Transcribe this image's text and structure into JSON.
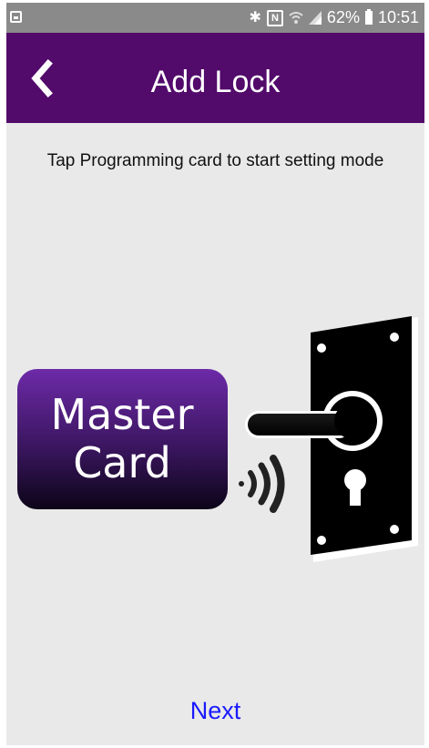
{
  "status_bar": {
    "battery_percent": "62%",
    "time": "10:51",
    "icons": [
      "screenshot-icon",
      "bluetooth-icon",
      "nfc-icon",
      "wifi-icon",
      "signal-icon",
      "battery-icon"
    ]
  },
  "header": {
    "title": "Add Lock",
    "back_icon": "chevron-left-icon",
    "background_color": "#520a6b"
  },
  "instruction": "Tap Programming card to start setting mode",
  "card": {
    "line1": "Master",
    "line2": "Card"
  },
  "footer": {
    "next_label": "Next",
    "next_color": "#1a1aff"
  }
}
